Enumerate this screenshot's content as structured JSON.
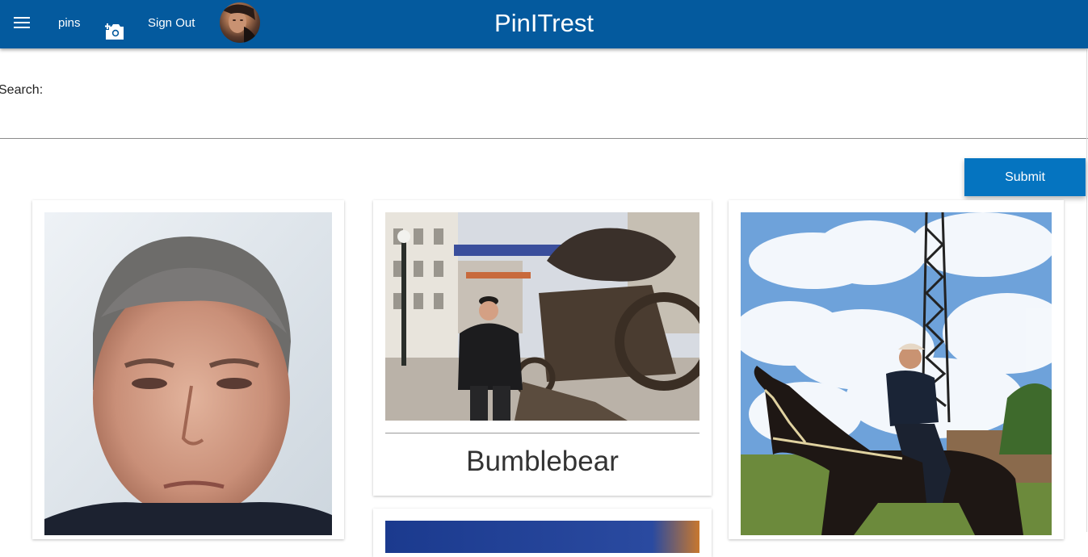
{
  "header": {
    "brand": "PinITrest",
    "pins_label": "pins",
    "signout_label": "Sign Out"
  },
  "search": {
    "label": "Search:",
    "value": "",
    "submit_label": "Submit"
  },
  "pins": [
    {
      "title": ""
    },
    {
      "title": "Bumblebear"
    },
    {
      "title": ""
    },
    {
      "title": ""
    }
  ],
  "colors": {
    "header_bg": "#045a9e",
    "button_bg": "#0574c0"
  },
  "icons": [
    "menu-icon",
    "camera-plus-icon",
    "avatar"
  ]
}
